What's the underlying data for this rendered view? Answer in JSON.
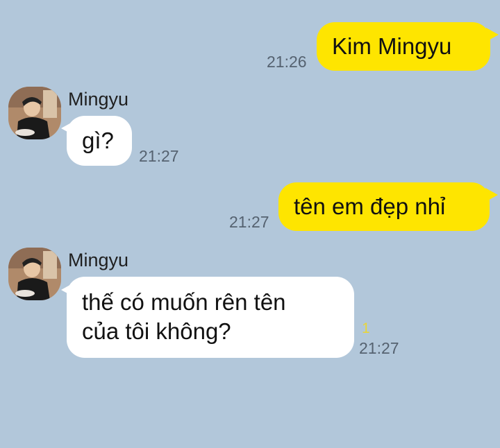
{
  "messages": [
    {
      "sender": "me",
      "text": "Kim Mingyu",
      "time": "21:26"
    },
    {
      "sender": "Mingyu",
      "text": "gì?",
      "time": "21:27"
    },
    {
      "sender": "me",
      "text": "tên em đẹp nhỉ",
      "time": "21:27"
    },
    {
      "sender": "Mingyu",
      "text_line1": "thế có muốn rên tên",
      "text_line2": "của tôi không?",
      "time": "21:27",
      "unread": "1"
    }
  ],
  "contact": {
    "name": "Mingyu",
    "avatar_icon": "profile-photo"
  },
  "colors": {
    "background": "#b2c7da",
    "outgoing_bubble": "#fee500",
    "incoming_bubble": "#ffffff",
    "unread_count": "#e8d53a"
  }
}
